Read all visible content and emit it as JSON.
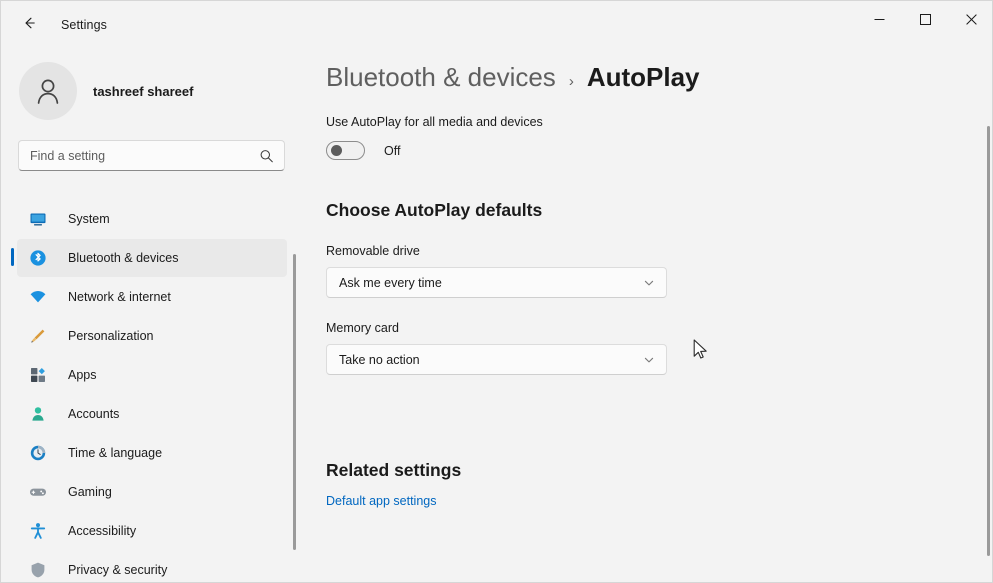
{
  "window": {
    "title": "Settings",
    "back_icon": "back-arrow-icon",
    "controls": {
      "minimize": "minimize-icon",
      "maximize": "maximize-icon",
      "close": "close-icon"
    }
  },
  "sidebar": {
    "profile": {
      "name": "tashreef shareef",
      "avatar_icon": "user-avatar-icon"
    },
    "search": {
      "placeholder": "Find a setting",
      "value": "",
      "icon": "search-icon"
    },
    "items": [
      {
        "label": "System",
        "icon": "monitor-icon",
        "selected": false
      },
      {
        "label": "Bluetooth & devices",
        "icon": "bluetooth-icon",
        "selected": true
      },
      {
        "label": "Network & internet",
        "icon": "wifi-icon",
        "selected": false
      },
      {
        "label": "Personalization",
        "icon": "paintbrush-icon",
        "selected": false
      },
      {
        "label": "Apps",
        "icon": "apps-grid-icon",
        "selected": false
      },
      {
        "label": "Accounts",
        "icon": "person-icon",
        "selected": false
      },
      {
        "label": "Time & language",
        "icon": "clock-icon",
        "selected": false
      },
      {
        "label": "Gaming",
        "icon": "gamepad-icon",
        "selected": false
      },
      {
        "label": "Accessibility",
        "icon": "accessibility-icon",
        "selected": false
      },
      {
        "label": "Privacy & security",
        "icon": "shield-icon",
        "selected": false
      }
    ]
  },
  "main": {
    "breadcrumb": {
      "parent": "Bluetooth & devices",
      "separator": "›",
      "current": "AutoPlay"
    },
    "master_toggle": {
      "caption": "Use AutoPlay for all media and devices",
      "state_label": "Off",
      "checked": false
    },
    "defaults_section": {
      "title": "Choose AutoPlay defaults",
      "fields": [
        {
          "label": "Removable drive",
          "value": "Ask me every time",
          "chevron": "chevron-down-icon"
        },
        {
          "label": "Memory card",
          "value": "Take no action",
          "chevron": "chevron-down-icon"
        }
      ]
    },
    "related": {
      "title": "Related settings",
      "link": "Default app settings"
    }
  },
  "theme": {
    "accent": "#0067c0",
    "link": "#0067c0",
    "background": "#f3f3f3",
    "surface": "#fbfbfb",
    "text": "#1b1b1b",
    "muted_text": "#5f5f5f"
  }
}
